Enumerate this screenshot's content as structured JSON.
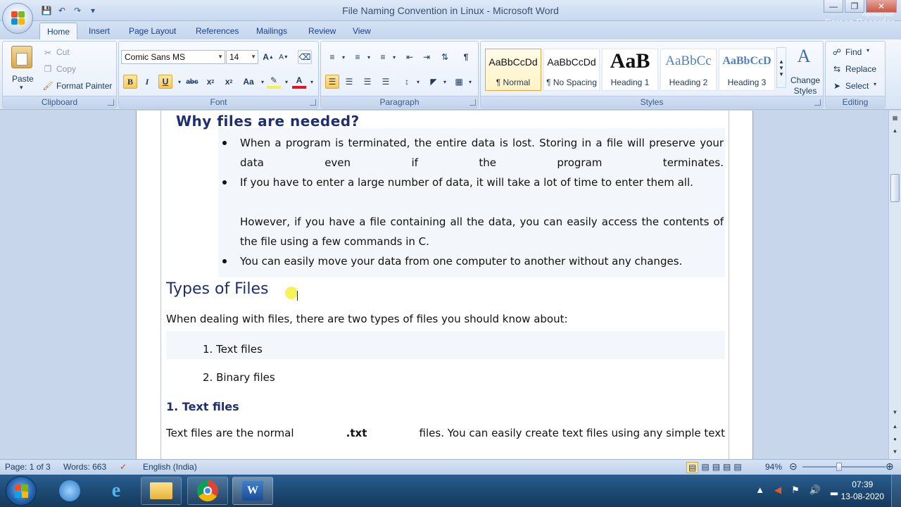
{
  "window": {
    "title": "File Naming Convention in Linux - Microsoft Word",
    "watermark_top": "Apowersoft",
    "watermark_bottom": "Screen Recorder"
  },
  "tabs": [
    "Home",
    "Insert",
    "Page Layout",
    "References",
    "Mailings",
    "Review",
    "View"
  ],
  "ribbon": {
    "clipboard": {
      "label": "Clipboard",
      "paste": "Paste",
      "cut": "Cut",
      "copy": "Copy",
      "format_painter": "Format Painter"
    },
    "font": {
      "label": "Font",
      "font_name": "Comic Sans MS",
      "font_size": "14"
    },
    "paragraph": {
      "label": "Paragraph"
    },
    "styles": {
      "label": "Styles",
      "items": [
        {
          "sample": "AaBbCcDd",
          "name": "¶ Normal"
        },
        {
          "sample": "AaBbCcDd",
          "name": "¶ No Spacing"
        },
        {
          "sample": "AaB",
          "name": "Heading 1"
        },
        {
          "sample": "AaBbCc",
          "name": "Heading 2"
        },
        {
          "sample": "AaBbCcD",
          "name": "Heading 3"
        }
      ],
      "change_styles": "Change Styles"
    },
    "editing": {
      "label": "Editing",
      "find": "Find",
      "replace": "Replace",
      "select": "Select"
    }
  },
  "document": {
    "heading_partial": "Why files are needed?",
    "bullets": [
      "When a program is terminated, the entire data is lost. Storing in a file will preserve your data even if the program terminates.",
      "If you have to enter a large number of data, it will take a lot of time to enter them all.",
      "However, if you have a file containing all the data, you can easily access the contents of the file using a few commands in C.",
      "You can easily move your data from one computer to another without any changes."
    ],
    "heading_types": "Types of Files",
    "intro": "When dealing with files, there are two types of files you should know about:",
    "list": [
      "1. Text files",
      "2. Binary files"
    ],
    "subheading": "1. Text files",
    "body_start": "Text files are the normal",
    "body_bold": ".txt",
    "body_end": "files. You can easily create text files using any simple text"
  },
  "status": {
    "page": "Page: 1 of 3",
    "words": "Words: 663",
    "language": "English (India)",
    "zoom": "94%"
  },
  "taskbar": {
    "time": "07:39",
    "date": "13-08-2020"
  },
  "colors": {
    "ribbon_accent": "#15428b",
    "heading": "#1f2f6e",
    "highlight": "#f6f04a"
  }
}
